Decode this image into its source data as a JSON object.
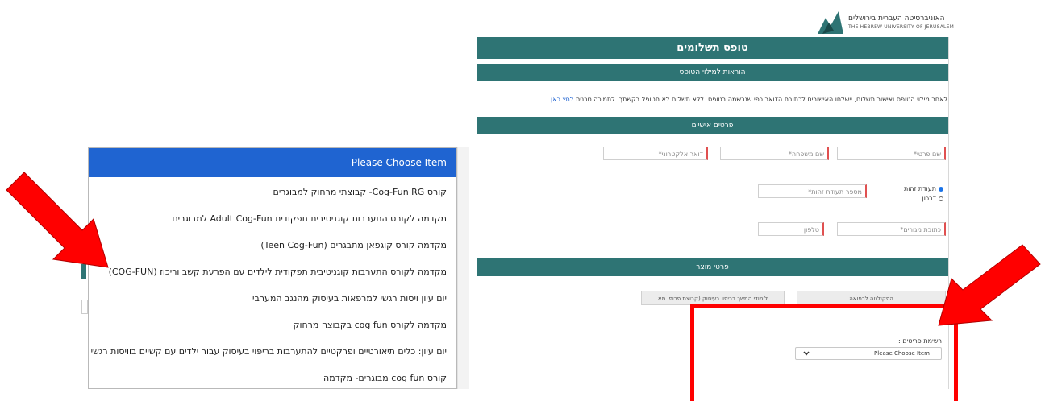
{
  "header": {
    "logo_hebrew": "האוניברסיטה העברית בירושלים",
    "logo_english": "THE HEBREW UNIVERSITY OF JERUSALEM"
  },
  "form": {
    "title": "טופס תשלומים",
    "instructions_header": "הוראות למילוי הטופס",
    "instructions_text": "לאחר מילוי הטופס ואישור תשלום, יישלחו האישורים לכתובת הדואר כפי שנרשמה בטופס. ללא תשלום לא תטופל בקשתך. לתמיכה טכנית",
    "instructions_link": "לחץ כאן",
    "personal_header": "פרטים אישיים",
    "fields": {
      "first_name": "שם פרטי*",
      "last_name": "שם משפחה*",
      "email": "דואר אלקטרוני*",
      "id_number": "מספר תעודת זהות*",
      "address": "כתובת מגורים*",
      "phone": "טלפון"
    },
    "radio_id": "תעודת זהות",
    "radio_passport": "דרכון",
    "product_header": "פרטי מוצר",
    "product_btn_1": "הפקולטה לרפואה",
    "product_btn_2": "לימודי המשך בריפוי בעיסוק (קבוצת פרופ' מא",
    "items_label": "רשימת פריטים :",
    "items_select_value": "Please Choose Item"
  },
  "dropdown": {
    "header": "Please Choose Item",
    "items": [
      "קורס Cog-Fun RG- קבוצתי מרחוק למבוגרים",
      "מקדמה לקורס התערבות קוגניטיבית תפקודית Adult Cog-Fun למבוגרים",
      "מקדמה קורס קוגפאן מתבגרים (Teen Cog-Fun)",
      "מקדמה לקורס התערבות קוגניטיבית תפקודית לילדים עם הפרעת קשב וריכוז (COG-FUN)",
      "יום עיון ויסות רגשי למרפאות בעיסוק מהנגב המערבי",
      "מקדמה לקורס cog fun בקבוצה מרחוק",
      "יום עיון: כלים תיאורטיים ופרקטיים להתערבות בריפוי בעיסוק עבור ילדים עם קשיים בוויסות רגשי",
      "קורס cog fun מבוגרים- מקדמה"
    ]
  },
  "colors": {
    "teal": "#2e7474",
    "dropdown_header": "#1f64d1",
    "annotation_red": "#ff0000"
  }
}
